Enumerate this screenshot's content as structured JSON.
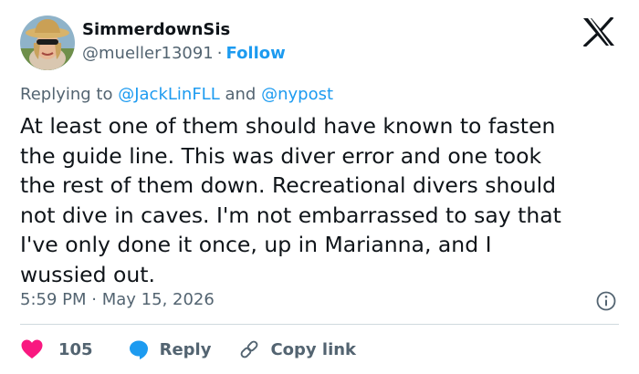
{
  "author": {
    "display_name": "SimmerdownSis",
    "handle": "@mueller13091",
    "separator": "·",
    "follow_label": "Follow"
  },
  "reply_context": {
    "prefix": "Replying to",
    "mention_1": "@JackLinFLL",
    "conjunction": "and",
    "mention_2": "@nypost"
  },
  "tweet": {
    "text": "At least one of them should have known to fasten\nthe guide line. This was diver error and one took\nthe rest of  them down.  Recreational divers should\nnot dive in caves. I'm not embarrassed to say that\nI've only done it once, up in Marianna, and I\nwussied out."
  },
  "meta": {
    "time": "5:59 PM",
    "separator": "·",
    "date": "May 15, 2026"
  },
  "actions": {
    "like_count": "105",
    "reply_label": "Reply",
    "copy_label": "Copy link"
  },
  "colors": {
    "accent": "#1d9bf0",
    "like": "#f91880",
    "text": "#0f1419",
    "muted": "#536471",
    "divider": "#cfd9de"
  },
  "icons": [
    "x-logo-icon",
    "info-icon",
    "heart-icon",
    "reply-bubble-icon",
    "link-icon"
  ]
}
